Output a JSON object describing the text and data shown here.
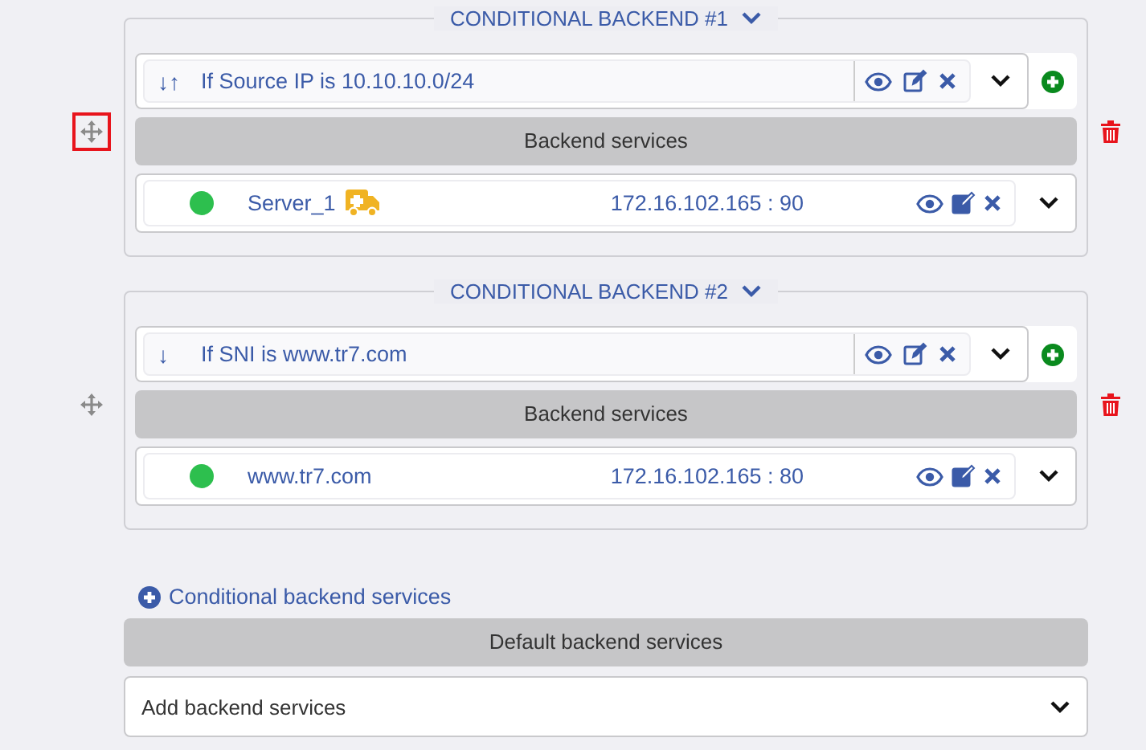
{
  "conditions": [
    {
      "title": "CONDITIONAL BACKEND #1",
      "highlighted": true,
      "rule": {
        "arrow": "↓↑",
        "text": "If Source IP is 10.10.10.0/24"
      },
      "section_label": "Backend services",
      "servers": [
        {
          "name": "Server_1",
          "color": "#2dbf4e",
          "flagged": true,
          "address": "172.16.102.165 : 90"
        }
      ]
    },
    {
      "title": "CONDITIONAL BACKEND #2",
      "highlighted": false,
      "rule": {
        "arrow": "↓",
        "text": "If SNI is www.tr7.com"
      },
      "section_label": "Backend services",
      "servers": [
        {
          "name": "www.tr7.com",
          "color": "#2dbf4e",
          "flagged": false,
          "address": "172.16.102.165 : 80"
        }
      ]
    }
  ],
  "add_link": "Conditional backend services",
  "default_section": {
    "label": "Default backend services",
    "select": {
      "value": "Add backend services"
    }
  }
}
